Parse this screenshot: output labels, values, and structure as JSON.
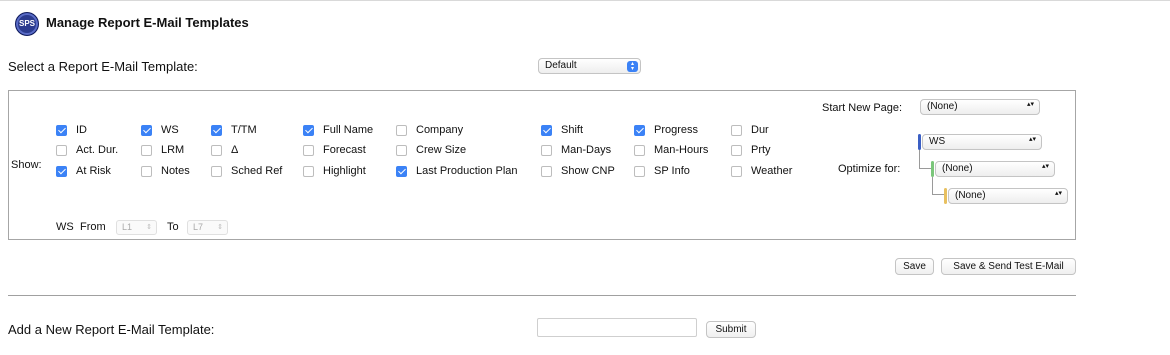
{
  "header": {
    "logo_text": "SPS",
    "title": "Manage Report E-Mail Templates"
  },
  "template_select": {
    "label": "Select a Report E-Mail Template:",
    "value": "Default"
  },
  "options": {
    "show_label": "Show:",
    "items": [
      {
        "label": "ID",
        "checked": true
      },
      {
        "label": "Act. Dur.",
        "checked": false
      },
      {
        "label": "At Risk",
        "checked": true
      },
      {
        "label": "WS",
        "checked": true
      },
      {
        "label": "LRM",
        "checked": false
      },
      {
        "label": "Notes",
        "checked": false
      },
      {
        "label": "T/TM",
        "checked": true
      },
      {
        "label": "Δ",
        "checked": false
      },
      {
        "label": "Sched Ref",
        "checked": false
      },
      {
        "label": "Full Name",
        "checked": true
      },
      {
        "label": "Forecast",
        "checked": false
      },
      {
        "label": "Highlight",
        "checked": false
      },
      {
        "label": "Company",
        "checked": false
      },
      {
        "label": "Crew Size",
        "checked": false
      },
      {
        "label": "Last Production Plan",
        "checked": true
      },
      {
        "label": "Shift",
        "checked": true
      },
      {
        "label": "Man-Days",
        "checked": false
      },
      {
        "label": "Show CNP",
        "checked": false
      },
      {
        "label": "Progress",
        "checked": true
      },
      {
        "label": "Man-Hours",
        "checked": false
      },
      {
        "label": "SP Info",
        "checked": false
      },
      {
        "label": "Dur",
        "checked": false
      },
      {
        "label": "Prty",
        "checked": false
      },
      {
        "label": "Weather",
        "checked": false
      }
    ],
    "ws_range": {
      "ws_label": "WS",
      "from_label": "From",
      "from_value": "L1",
      "to_label": "To",
      "to_value": "L7"
    },
    "start_new_page": {
      "label": "Start New Page:",
      "value": "(None)"
    },
    "optimize": {
      "label": "Optimize for:",
      "levels": [
        {
          "value": "WS",
          "color": "#3b5fc4"
        },
        {
          "value": "(None)",
          "color": "#7bc67b"
        },
        {
          "value": "(None)",
          "color": "#e8c060"
        }
      ]
    }
  },
  "actions": {
    "save": "Save",
    "save_send": "Save & Send Test E-Mail"
  },
  "new_template": {
    "label": "Add a New Report E-Mail Template:",
    "input_value": "",
    "submit": "Submit"
  }
}
